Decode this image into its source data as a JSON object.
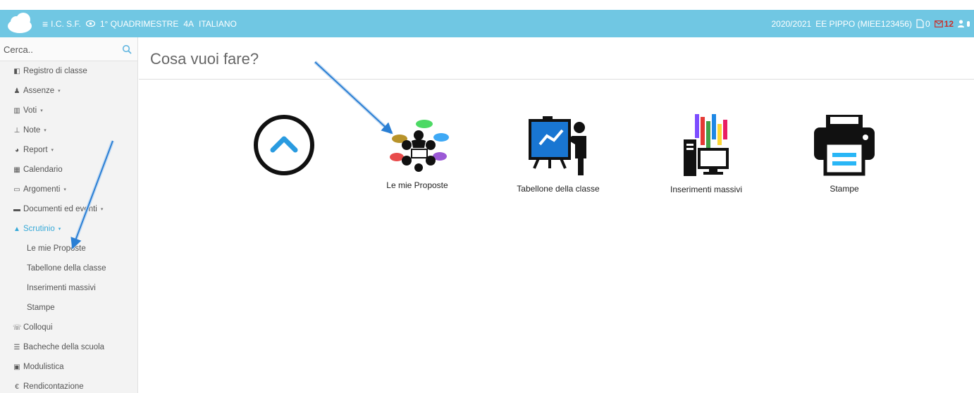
{
  "header": {
    "menu_glyph": "≡",
    "school": "I.C. S.F.",
    "eye_glyph": "👁",
    "period": "1° QUADRIMESTRE",
    "class_name": "4A",
    "subject": "ITALIANO",
    "year": "2020/2021",
    "user": "EE PIPPO (MIEE123456)",
    "doc_count": "0",
    "mail_count": "12",
    "bar_color": "#70c7e3"
  },
  "sidebar": {
    "search_placeholder": "Cerca..",
    "items": [
      {
        "label": "Registro di classe",
        "icon": "book-icon",
        "glyph": "◧"
      },
      {
        "label": "Assenze",
        "icon": "user-icon",
        "glyph": "♟",
        "caret": "▾"
      },
      {
        "label": "Voti",
        "icon": "institution-icon",
        "glyph": "▥",
        "caret": "▾"
      },
      {
        "label": "Note",
        "icon": "pin-icon",
        "glyph": "⊥",
        "caret": "▾"
      },
      {
        "label": "Report",
        "icon": "pie-chart-icon",
        "glyph": "◕",
        "caret": "▾"
      },
      {
        "label": "Calendario",
        "icon": "calendar-icon",
        "glyph": "▦"
      },
      {
        "label": "Argomenti",
        "icon": "folder-open-icon",
        "glyph": "▭",
        "caret": "▾"
      },
      {
        "label": "Documenti ed eventi",
        "icon": "folder-icon",
        "glyph": "▬",
        "caret": "▾"
      },
      {
        "label": "Scrutinio",
        "icon": "graduation-cap-icon",
        "glyph": "▲",
        "caret": "▾",
        "active": true
      },
      {
        "label": "Le mie Proposte",
        "sub": true
      },
      {
        "label": "Tabellone della classe",
        "sub": true
      },
      {
        "label": "Inserimenti massivi",
        "sub": true
      },
      {
        "label": "Stampe",
        "sub": true
      },
      {
        "label": "Colloqui",
        "icon": "chat-icon",
        "glyph": "☏"
      },
      {
        "label": "Bacheche della scuola",
        "icon": "list-icon",
        "glyph": "☰"
      },
      {
        "label": "Modulistica",
        "icon": "briefcase-icon",
        "glyph": "▣"
      },
      {
        "label": "Rendicontazione",
        "icon": "euro-icon",
        "glyph": "€"
      }
    ]
  },
  "main": {
    "title": "Cosa vuoi fare?",
    "tiles": [
      {
        "label": "",
        "icon": "circle-up-icon"
      },
      {
        "label": "Le mie Proposte",
        "icon": "meeting-icon"
      },
      {
        "label": "Tabellone della classe",
        "icon": "presentation-icon"
      },
      {
        "label": "Inserimenti massivi",
        "icon": "computer-data-icon"
      },
      {
        "label": "Stampe",
        "icon": "printer-icon"
      }
    ]
  },
  "colors": {
    "accent": "#36a9d8",
    "arrow": "#2a7fd4",
    "mail": "#c9302c"
  }
}
